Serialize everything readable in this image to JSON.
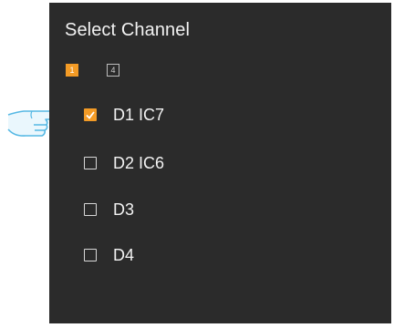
{
  "panel": {
    "title": "Select Channel"
  },
  "layout_options": [
    {
      "label": "1",
      "selected": true
    },
    {
      "label": "4",
      "selected": false
    }
  ],
  "channels": [
    {
      "label": "D1 IC7",
      "checked": true
    },
    {
      "label": "D2 IC6",
      "checked": false
    },
    {
      "label": "D3",
      "checked": false
    },
    {
      "label": "D4",
      "checked": false
    }
  ],
  "colors": {
    "panel_bg": "#2b2b2b",
    "accent": "#f39b26",
    "text": "#f2f2f2"
  },
  "icons": {
    "pointer": "pointing-hand-icon",
    "check": "checkmark-icon"
  }
}
